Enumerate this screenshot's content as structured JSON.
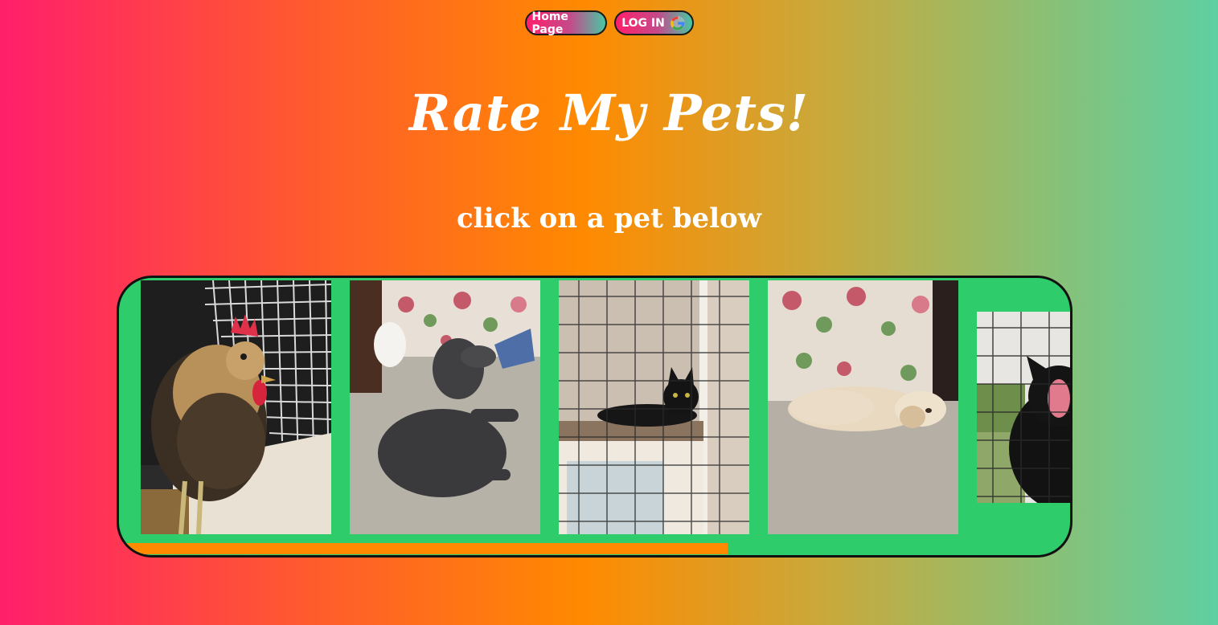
{
  "nav": {
    "home_label": "Home Page",
    "login_label": "LOG IN",
    "login_icon": "google-g-icon"
  },
  "header": {
    "title": "Rate My Pets!",
    "subtitle": "click on a pet below"
  },
  "gallery": {
    "background_color": "#2ecc6a",
    "scrollbar_color": "#ff8a00",
    "scroll_progress": 0.64,
    "pets": [
      {
        "name": "rooster",
        "description": "rooster in cage"
      },
      {
        "name": "poodle",
        "description": "grey poodle on carpet"
      },
      {
        "name": "black-cat",
        "description": "black cat behind screen"
      },
      {
        "name": "cocker-spaniel",
        "description": "cream dog sleeping"
      },
      {
        "name": "black-cat-yawning",
        "description": "black cat yawning"
      }
    ]
  },
  "colors": {
    "gradient": [
      "#ff1f6b",
      "#ff8a00",
      "#5fcfa2"
    ],
    "text": "#ffffff"
  }
}
